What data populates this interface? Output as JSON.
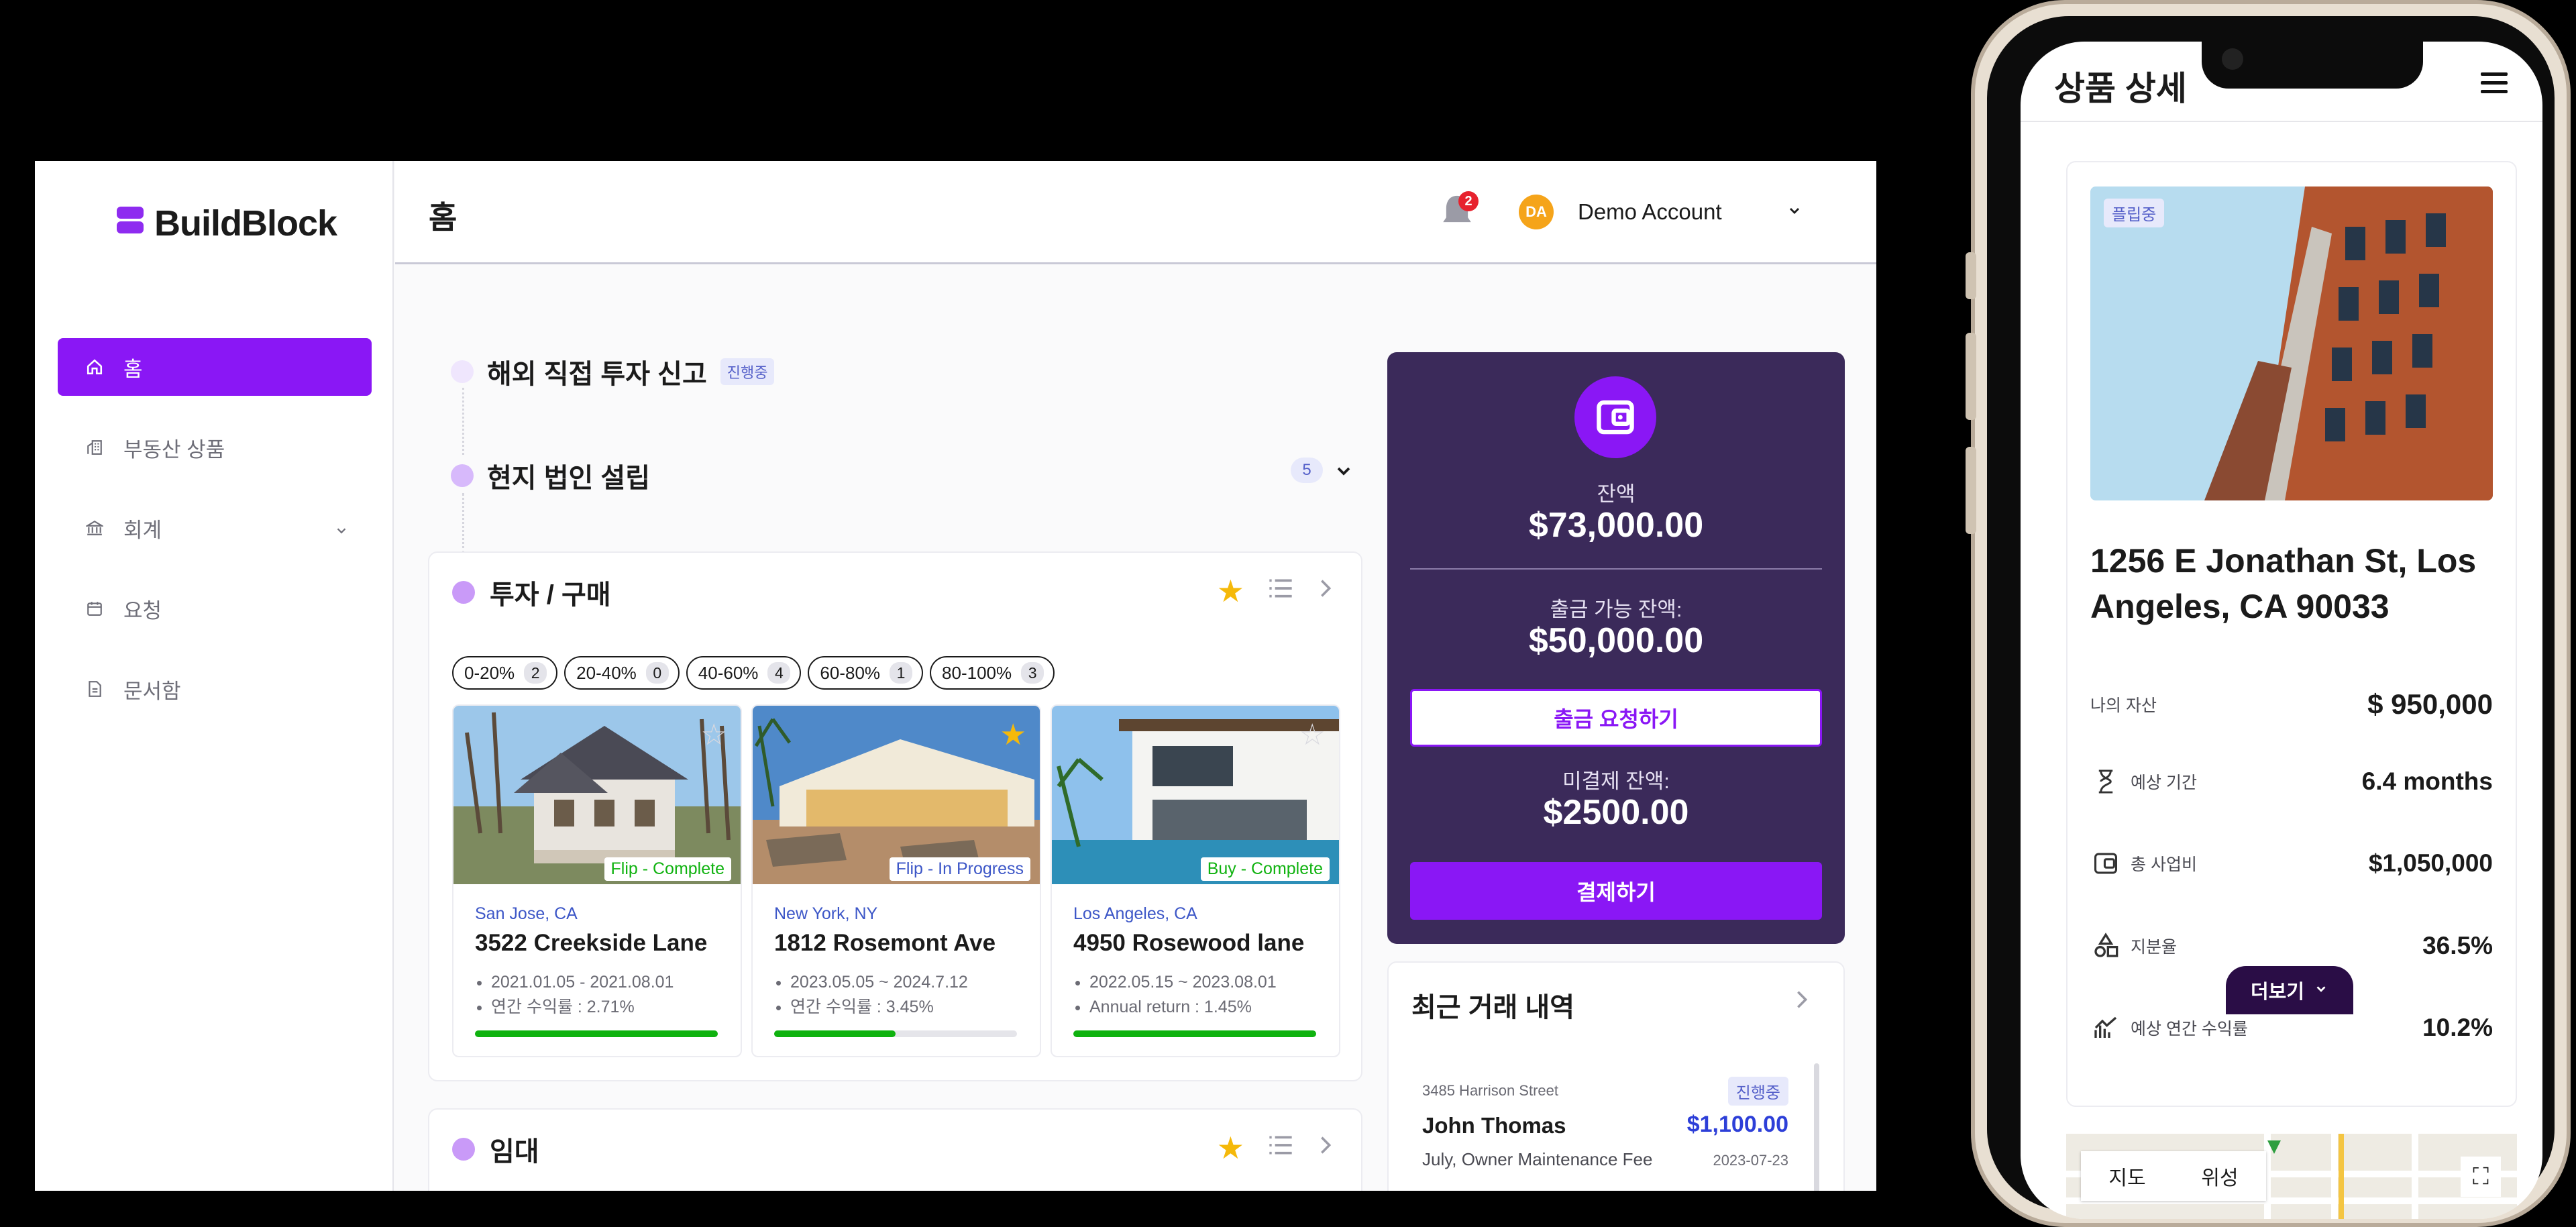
{
  "sidebar": {
    "logo": "BuildBlock",
    "items": [
      {
        "label": "홈"
      },
      {
        "label": "부동산 상품"
      },
      {
        "label": "회계"
      },
      {
        "label": "요청"
      },
      {
        "label": "문서함"
      }
    ]
  },
  "header": {
    "title": "홈",
    "notification_count": "2",
    "account_initials": "DA",
    "account_name": "Demo Account"
  },
  "steps": {
    "overseas": {
      "label": "해외 직접 투자 신고",
      "status": "진행중"
    },
    "local": {
      "label": "현지 법인 설립",
      "count": "5"
    }
  },
  "invest": {
    "title": "투자 / 구매",
    "filters": [
      {
        "label": "0-20%",
        "count": "2"
      },
      {
        "label": "20-40%",
        "count": "0"
      },
      {
        "label": "40-60%",
        "count": "4"
      },
      {
        "label": "60-80%",
        "count": "1"
      },
      {
        "label": "80-100%",
        "count": "3"
      }
    ],
    "properties": [
      {
        "city": "San Jose, CA",
        "address": "3522 Creekside Lane",
        "period": "2021.01.05 - 2021.08.01",
        "returns": "연간 수익률 :  2.71%",
        "tag": "Flip - Complete",
        "tag_color": "#0fb20f",
        "progress": 1.0
      },
      {
        "city": "New York, NY",
        "address": "1812 Rosemont Ave",
        "period": "2023.05.05 ~ 2024.7.12",
        "returns": "연간 수익률 :  3.45%",
        "tag": "Flip - In Progress",
        "tag_color": "#3c56c7",
        "progress": 0.5
      },
      {
        "city": "Los Angeles, CA",
        "address": "4950 Rosewood lane",
        "period": "2022.05.15 ~ 2023.08.01",
        "returns": "Annual return :  1.45%",
        "tag": "Buy - Complete",
        "tag_color": "#0fb20f",
        "progress": 1.0
      }
    ]
  },
  "rent": {
    "title": "임대"
  },
  "balance": {
    "label": "잔액",
    "value": "$73,000.00",
    "withdrawable_label": "출금 가능 잔액:",
    "withdrawable_value": "$50,000.00",
    "withdraw_button": "출금 요청하기",
    "unpaid_label": "미결제 잔액:",
    "unpaid_value": "$2500.00",
    "pay_button": "결제하기"
  },
  "recent": {
    "title": "최근 거래 내역",
    "street": "3485 Harrison Street",
    "status": "진행중",
    "name": "John Thomas",
    "amount": "$1,100.00",
    "desc": "July, Owner Maintenance Fee",
    "date": "2023-07-23"
  },
  "mobile": {
    "title": "상품 상세",
    "badge": "플립중",
    "address": "1256 E Jonathan St, Los Angeles, CA 90033",
    "my_asset_label": "나의 자산",
    "my_asset_value": "$ 950,000",
    "rows": [
      {
        "label": "예상 기간",
        "value": "6.4 months"
      },
      {
        "label": "총 사업비",
        "value": "$1,050,000"
      },
      {
        "label": "지분율",
        "value": "36.5%"
      },
      {
        "label": "예상 연간 수익률",
        "value": "10.2%"
      }
    ],
    "more_button": "더보기",
    "map_tab_map": "지도",
    "map_tab_satellite": "위성"
  },
  "colors": {
    "accent": "#8a17f5",
    "panel": "#3b2a5a",
    "complete": "#0fb20f",
    "link": "#3c56c7"
  }
}
